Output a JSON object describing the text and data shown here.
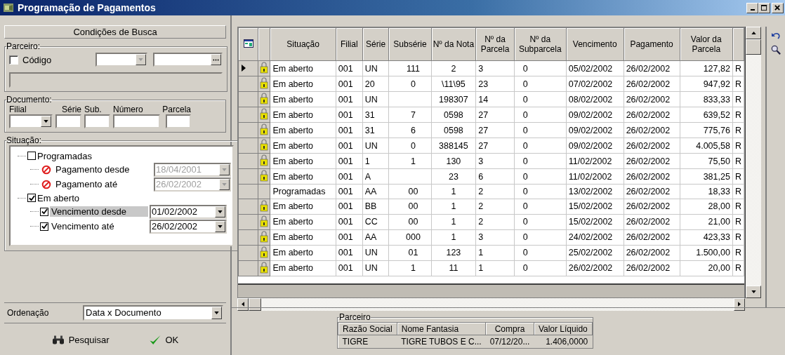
{
  "window": {
    "title": "Programação de Pagamentos"
  },
  "search_panel": {
    "title": "Condições de Busca",
    "partner": {
      "legend": "Parceiro:",
      "code_checkbox": {
        "label": "Código",
        "checked": false
      }
    },
    "document": {
      "legend": "Documento:",
      "fields": [
        {
          "label": "Filial",
          "kind": "dropdown"
        },
        {
          "label": "Série",
          "kind": "text"
        },
        {
          "label": "Sub.",
          "kind": "text"
        },
        {
          "label": "Número",
          "kind": "text"
        },
        {
          "label": "Parcela",
          "kind": "text"
        }
      ]
    },
    "status": {
      "legend": "Situação:",
      "tree": [
        {
          "label": "Programadas",
          "checked": false,
          "children": [
            {
              "label": "Pagamento desde",
              "kind": "blocked",
              "selected": false,
              "date": "18/04/2001",
              "disabled": true
            },
            {
              "label": "Pagamento até",
              "kind": "blocked",
              "selected": false,
              "date": "26/02/2002",
              "disabled": true
            }
          ]
        },
        {
          "label": "Em aberto",
          "checked": true,
          "children": [
            {
              "label": "Vencimento desde",
              "kind": "checkbox",
              "checked": true,
              "selected": true,
              "date": "01/02/2002",
              "disabled": false
            },
            {
              "label": "Vencimento até",
              "kind": "checkbox",
              "checked": true,
              "selected": false,
              "date": "26/02/2002",
              "disabled": false
            }
          ]
        }
      ]
    },
    "ordering": {
      "label": "Ordenação",
      "value": "Data x Documento"
    },
    "buttons": [
      {
        "label": "Pesquisar",
        "kind": "search"
      },
      {
        "label": "OK",
        "kind": "ok"
      }
    ]
  },
  "grid": {
    "columns": [
      "Situação",
      "Filial",
      "Série",
      "Subsérie",
      "Nº da Nota",
      "Nº da Parcela",
      "Nº da Subparcela",
      "Vencimento",
      "Pagamento",
      "Valor da Parcela"
    ],
    "rows": [
      {
        "current": true,
        "locked": true,
        "cells": [
          "Em aberto",
          "001",
          "UN",
          "111",
          "2",
          "3",
          "0",
          "05/02/2002",
          "26/02/2002",
          "127,82",
          "R"
        ]
      },
      {
        "current": false,
        "locked": true,
        "cells": [
          "Em aberto",
          "001",
          "20",
          "0",
          "\\11\\95",
          "23",
          "0",
          "07/02/2002",
          "26/02/2002",
          "947,92",
          "R"
        ]
      },
      {
        "current": false,
        "locked": true,
        "cells": [
          "Em aberto",
          "001",
          "UN",
          "",
          "198307",
          "14",
          "0",
          "08/02/2002",
          "26/02/2002",
          "833,33",
          "R"
        ]
      },
      {
        "current": false,
        "locked": true,
        "cells": [
          "Em aberto",
          "001",
          "31",
          "7",
          "0598",
          "27",
          "0",
          "09/02/2002",
          "26/02/2002",
          "639,52",
          "R"
        ]
      },
      {
        "current": false,
        "locked": true,
        "cells": [
          "Em aberto",
          "001",
          "31",
          "6",
          "0598",
          "27",
          "0",
          "09/02/2002",
          "26/02/2002",
          "775,76",
          "R"
        ]
      },
      {
        "current": false,
        "locked": true,
        "cells": [
          "Em aberto",
          "001",
          "UN",
          "0",
          "388145",
          "27",
          "0",
          "09/02/2002",
          "26/02/2002",
          "4.005,58",
          "R"
        ]
      },
      {
        "current": false,
        "locked": true,
        "cells": [
          "Em aberto",
          "001",
          "1",
          "1",
          "130",
          "3",
          "0",
          "11/02/2002",
          "26/02/2002",
          "75,50",
          "R"
        ]
      },
      {
        "current": false,
        "locked": true,
        "cells": [
          "Em aberto",
          "001",
          "A",
          "",
          "23",
          "6",
          "0",
          "11/02/2002",
          "26/02/2002",
          "381,25",
          "R"
        ]
      },
      {
        "current": false,
        "locked": false,
        "cells": [
          "Programadas",
          "001",
          "AA",
          "00",
          "1",
          "2",
          "0",
          "13/02/2002",
          "26/02/2002",
          "18,33",
          "R"
        ]
      },
      {
        "current": false,
        "locked": true,
        "cells": [
          "Em aberto",
          "001",
          "BB",
          "00",
          "1",
          "2",
          "0",
          "15/02/2002",
          "26/02/2002",
          "28,00",
          "R"
        ]
      },
      {
        "current": false,
        "locked": true,
        "cells": [
          "Em aberto",
          "001",
          "CC",
          "00",
          "1",
          "2",
          "0",
          "15/02/2002",
          "26/02/2002",
          "21,00",
          "R"
        ]
      },
      {
        "current": false,
        "locked": true,
        "cells": [
          "Em aberto",
          "001",
          "AA",
          "000",
          "1",
          "3",
          "0",
          "24/02/2002",
          "26/02/2002",
          "423,33",
          "R"
        ]
      },
      {
        "current": false,
        "locked": true,
        "cells": [
          "Em aberto",
          "001",
          "UN",
          "01",
          "123",
          "1",
          "0",
          "25/02/2002",
          "26/02/2002",
          "1.500,00",
          "R"
        ]
      },
      {
        "current": false,
        "locked": true,
        "cells": [
          "Em aberto",
          "001",
          "UN",
          "1",
          "11",
          "1",
          "0",
          "26/02/2002",
          "26/02/2002",
          "20,00",
          "R"
        ]
      }
    ]
  },
  "partner_summary": {
    "legend": "Parceiro",
    "columns": [
      "Razão Social",
      "Nome Fantasia",
      "Compra",
      "Valor Líquido"
    ],
    "row": [
      "TIGRE",
      "TIGRE TUBOS E C...",
      "07/12/20...",
      "1.406,0000"
    ]
  }
}
